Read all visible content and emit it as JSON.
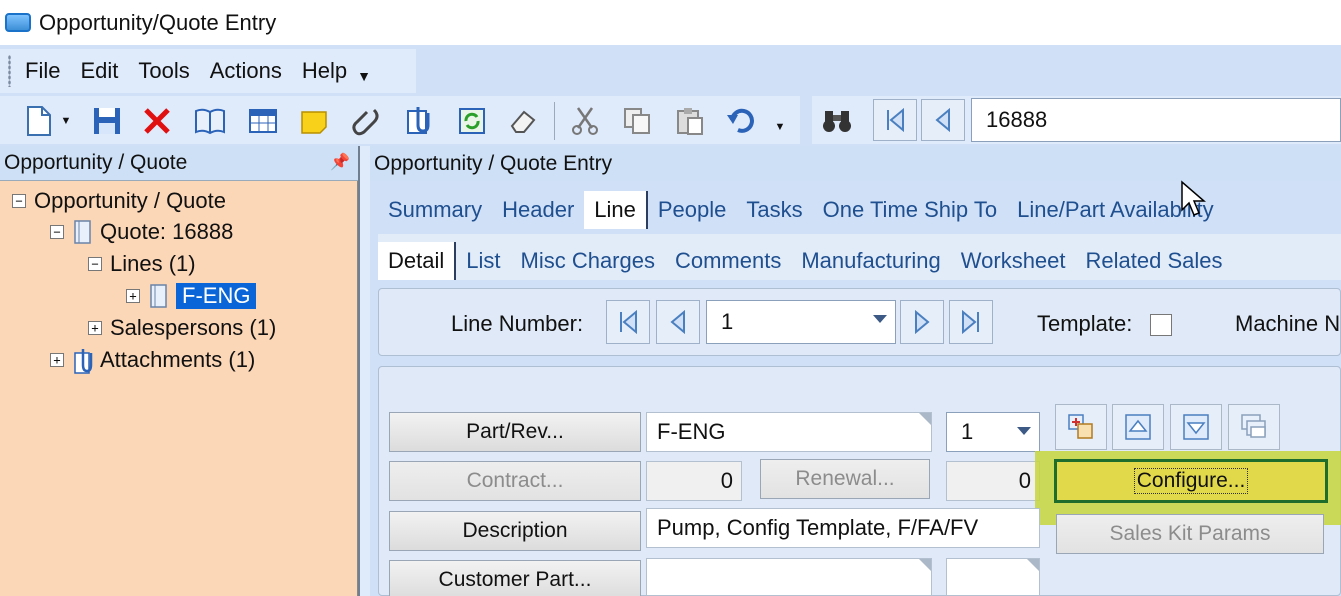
{
  "window": {
    "title": "Opportunity/Quote Entry"
  },
  "menu": [
    "File",
    "Edit",
    "Tools",
    "Actions",
    "Help"
  ],
  "toolbar": {
    "icons": [
      "new-icon",
      "save-icon",
      "delete-icon",
      "book-icon",
      "grid-icon",
      "note-icon",
      "attach-icon",
      "clip-icon",
      "refresh-icon",
      "eraser-icon",
      "cut-icon",
      "copy-icon",
      "paste-icon",
      "undo-icon",
      "binoculars-icon",
      "first-icon",
      "prev-icon"
    ],
    "search_value": "16888"
  },
  "left_panel": {
    "title": "Opportunity / Quote",
    "tree": [
      {
        "label": "Opportunity / Quote",
        "expander": "−"
      },
      {
        "label": "Quote: 16888",
        "expander": "−"
      },
      {
        "label": "Lines (1)",
        "expander": "−"
      },
      {
        "label": "F-ENG",
        "expander": "+"
      },
      {
        "label": "Salespersons (1)",
        "expander": "+"
      },
      {
        "label": "Attachments (1)",
        "expander": "+"
      }
    ]
  },
  "right_panel": {
    "title": "Opportunity / Quote Entry",
    "tabs": [
      "Summary",
      "Header",
      "Line",
      "People",
      "Tasks",
      "One Time Ship To",
      "Line/Part Availability"
    ],
    "subtabs": [
      "Detail",
      "List",
      "Misc Charges",
      "Comments",
      "Manufacturing",
      "Worksheet",
      "Related Sales"
    ]
  },
  "line_bar": {
    "line_number_label": "Line Number:",
    "line_number_value": "1",
    "template_label": "Template:",
    "machine_label": "Machine N"
  },
  "detail": {
    "part_rev_button": "Part/Rev...",
    "part_value": "F-ENG",
    "rev_value": "1",
    "contract_button": "Contract...",
    "contract_value": "0",
    "renewal_button": "Renewal...",
    "renewal_value": "0",
    "configure_button": "Configure...",
    "description_button": "Description",
    "description_value": "Pump, Config Template, F/FA/FV",
    "sales_kit_button": "Sales Kit Params",
    "customer_part_button": "Customer Part..."
  },
  "colors": {
    "accent": "#0a66d8",
    "tree_bg": "#fbd7b8",
    "panel_bg": "#cfe0f7",
    "highlight": "#c8d63c"
  }
}
